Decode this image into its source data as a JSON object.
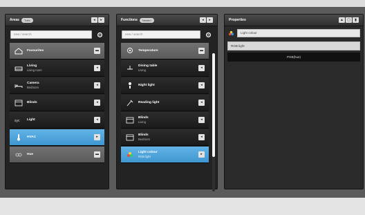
{
  "areas": {
    "title": "Areas",
    "badge": "Tutto",
    "search_placeholder": "new / search",
    "header_buttons": [
      "◂",
      "▸"
    ],
    "items": [
      {
        "label": "Favourites",
        "sub": "",
        "icon": "home-icon",
        "button": "▬",
        "style": "grey"
      },
      {
        "label": "Living",
        "sub": "Living room",
        "icon": "sofa-icon",
        "button": "◂",
        "style": "dark"
      },
      {
        "label": "Camera",
        "sub": "Bedroom",
        "icon": "bed-icon",
        "button": "◂",
        "style": "dark"
      },
      {
        "label": "Blinds",
        "sub": "",
        "icon": "blinds-icon",
        "button": "◂",
        "style": "dark"
      },
      {
        "label": "Light",
        "sub": "",
        "icon": "light-text-icon",
        "button": "◂",
        "style": "dark"
      },
      {
        "label": "HVAC",
        "sub": "",
        "icon": "thermometer-icon",
        "button": "▸",
        "style": "active"
      },
      {
        "label": "Hue",
        "sub": "",
        "icon": "hue-icon",
        "button": "▬",
        "style": "grey"
      }
    ]
  },
  "functions": {
    "title": "Functions",
    "badge": "Nested",
    "search_placeholder": "new / search",
    "header_buttons": [
      "◂",
      "▸"
    ],
    "items": [
      {
        "label": "Temperature",
        "sub": "",
        "icon": "thermostat-icon",
        "button": "▬",
        "style": "grey"
      },
      {
        "label": "Dining table",
        "sub": "Living",
        "icon": "lamp-icon",
        "button": "◂",
        "style": "dark"
      },
      {
        "label": "Night light",
        "sub": "",
        "icon": "night-light-icon",
        "button": "◂",
        "style": "dark"
      },
      {
        "label": "Reading light",
        "sub": "",
        "icon": "reading-light-icon",
        "button": "◂",
        "style": "dark"
      },
      {
        "label": "Blinds",
        "sub": "Living",
        "icon": "blinds-icon",
        "button": "◂",
        "style": "dark"
      },
      {
        "label": "Blinds",
        "sub": "Bedroom",
        "icon": "blinds-icon",
        "button": "◂",
        "style": "dark"
      },
      {
        "label": "Light colour",
        "sub": "RGB light",
        "icon": "color-wheel-icon",
        "button": "▸",
        "style": "active"
      }
    ]
  },
  "properties": {
    "title": "Properties",
    "header_buttons": [
      "▲",
      "▢",
      "▮"
    ],
    "field1": "Light colour",
    "field2": "RGB light",
    "bar_label": "PGB(hue)"
  }
}
